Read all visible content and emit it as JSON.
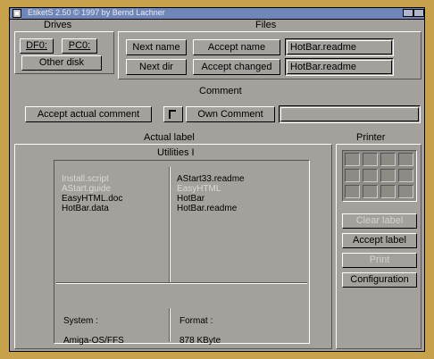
{
  "window": {
    "title": "EtiketS 2.50 © 1997 by Bernd Lachner"
  },
  "drives": {
    "heading": "Drives",
    "df0": "DF0:",
    "pc0": "PC0:",
    "other_disk": "Other disk"
  },
  "files": {
    "heading": "Files",
    "next_name": "Next name",
    "accept_name": "Accept name",
    "next_dir": "Next dir",
    "accept_changed": "Accept changed",
    "name_field": "HotBar.readme",
    "changed_field": "HotBar.readme"
  },
  "comment": {
    "heading": "Comment",
    "accept_actual": "Accept actual comment",
    "own_comment": "Own Comment",
    "field_value": ""
  },
  "label": {
    "heading": "Actual label",
    "title": "Utilities I",
    "col1": [
      "Install.script",
      "AStart.guide",
      "EasyHTML.doc",
      "HotBar.data"
    ],
    "col2": [
      "AStart33.readme",
      "EasyHTML",
      "HotBar",
      "HotBar.readme"
    ],
    "system_label": "System :",
    "system_value": "Amiga-OS/FFS",
    "format_label": "Format :",
    "format_value": "878 KByte"
  },
  "printer": {
    "heading": "Printer",
    "clear_label": "Clear label",
    "accept_label": "Accept label",
    "print": "Print",
    "configuration": "Configuration"
  }
}
